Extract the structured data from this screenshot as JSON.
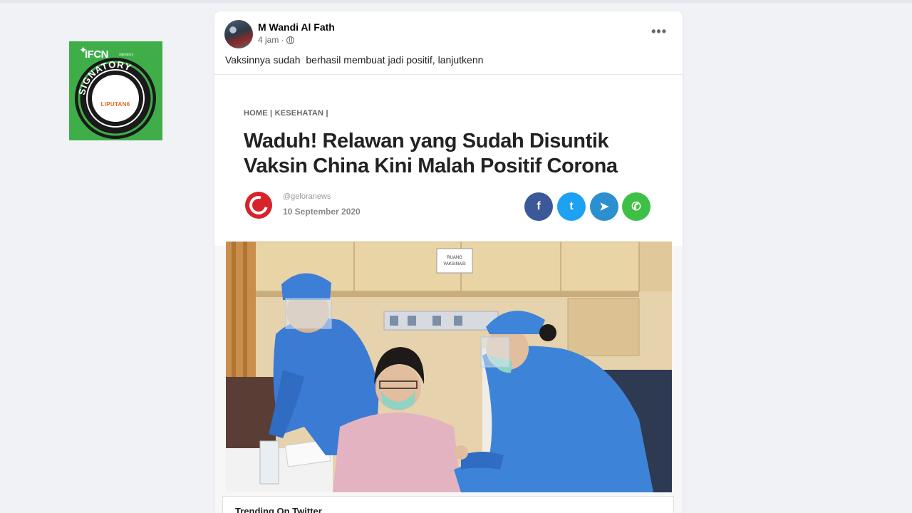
{
  "badge": {
    "title": "IFCN",
    "subtitle": "signatory",
    "ring_text": "SIGNATORY",
    "center_label": "LIPUTAN6"
  },
  "post": {
    "author": "M Wandi Al Fath",
    "time": "4 jam ·",
    "more": "•••",
    "text": "Vaksinnya sudah  berhasil membuat jadi positif, lanjutkenn"
  },
  "article": {
    "breadcrumb": "HOME | KESEHATAN |",
    "headline": "Waduh! Relawan yang Sudah Disuntik Vaksin China Kini Malah Positif Corona",
    "handle": "@geloranews",
    "date": "10 September 2020",
    "share": {
      "facebook": "f",
      "twitter": "t",
      "telegram": "➤",
      "whatsapp": "✆"
    },
    "photo_sign": "RUANG VAKSINASI",
    "trending": "Trending On Twitter"
  },
  "colors": {
    "facebook": "#3b5998",
    "twitter": "#1da1f2",
    "telegram": "#2c8fcf",
    "whatsapp": "#3ec046",
    "publisher": "#d8232a",
    "badge_green": "#3fae49"
  }
}
